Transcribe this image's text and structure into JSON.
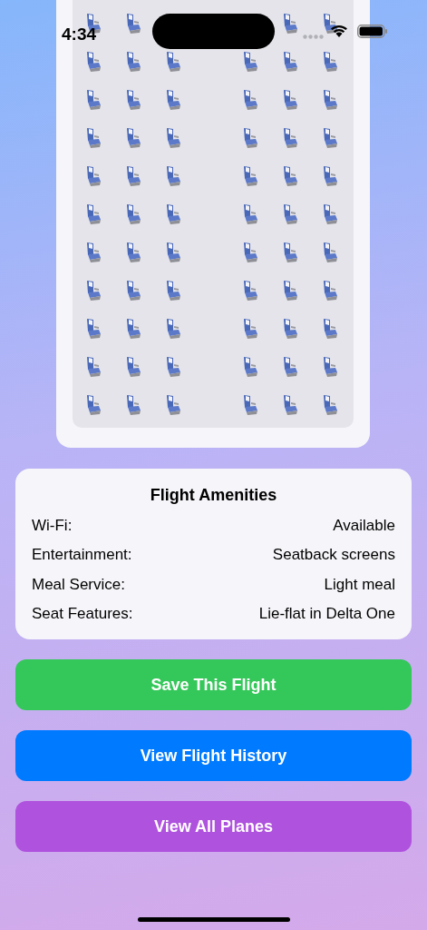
{
  "status_bar": {
    "time": "4:34"
  },
  "amenities": {
    "title": "Flight Amenities",
    "rows": [
      {
        "label": "Wi-Fi:",
        "value": "Available"
      },
      {
        "label": "Entertainment:",
        "value": "Seatback screens"
      },
      {
        "label": "Meal Service:",
        "value": "Light meal"
      },
      {
        "label": "Seat Features:",
        "value": "Lie-flat in Delta One"
      }
    ]
  },
  "buttons": [
    {
      "label": "Save This Flight",
      "color": "#34c759"
    },
    {
      "label": "View Flight History",
      "color": "#007aff"
    },
    {
      "label": "View All Planes",
      "color": "#af52de"
    }
  ]
}
